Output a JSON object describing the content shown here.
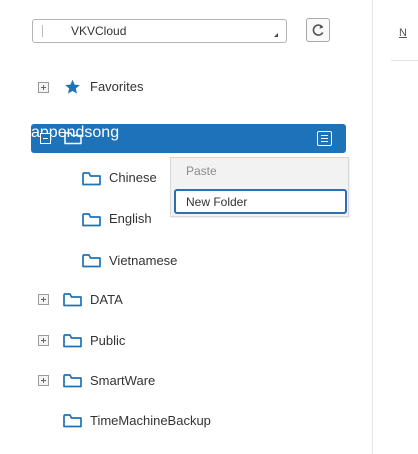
{
  "device_selector": {
    "value": "VKVCloud"
  },
  "main": {
    "header_label": "N"
  },
  "tree": {
    "favorites": {
      "label": "Favorites"
    },
    "selected": {
      "label": "appendsong"
    },
    "children": [
      {
        "label": "Chinese"
      },
      {
        "label": "English"
      },
      {
        "label": "Vietnamese"
      }
    ],
    "folders": [
      {
        "label": "DATA"
      },
      {
        "label": "Public"
      },
      {
        "label": "SmartWare"
      },
      {
        "label": "TimeMachineBackup"
      }
    ]
  },
  "context_menu": {
    "paste": "Paste",
    "new_folder": "New Folder"
  },
  "colors": {
    "accent": "#1d72b8",
    "folder": "#1d72b8",
    "menu_focus": "#2b6fb0"
  }
}
